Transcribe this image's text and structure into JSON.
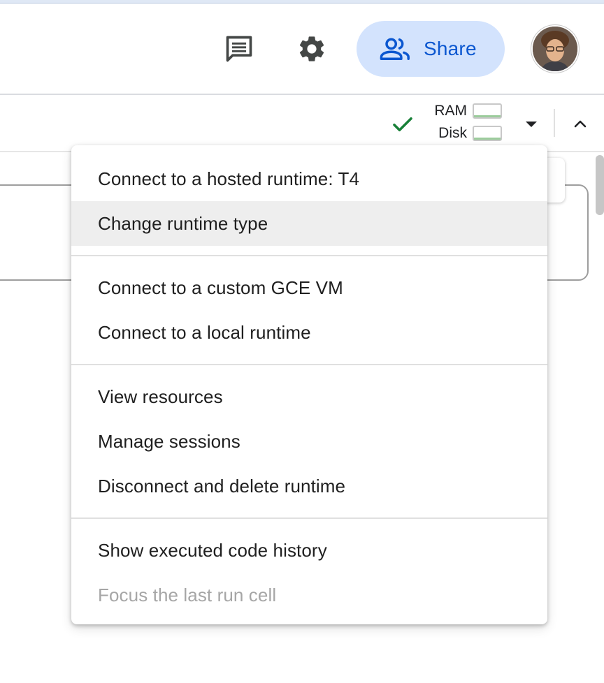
{
  "header": {
    "share_label": "Share",
    "icons": {
      "comment": "comment-icon",
      "settings": "gear-icon",
      "share": "people-icon",
      "avatar": "user-avatar"
    }
  },
  "toolbar": {
    "ram_label": "RAM",
    "disk_label": "Disk",
    "status_icon": "checkmark-icon",
    "dropdown_icon": "caret-down-icon",
    "collapse_icon": "chevron-up-icon"
  },
  "menu": {
    "groups": [
      [
        {
          "label": "Connect to a hosted runtime: T4",
          "highlighted": false,
          "disabled": false
        },
        {
          "label": "Change runtime type",
          "highlighted": true,
          "disabled": false
        }
      ],
      [
        {
          "label": "Connect to a custom GCE VM",
          "highlighted": false,
          "disabled": false
        },
        {
          "label": "Connect to a local runtime",
          "highlighted": false,
          "disabled": false
        }
      ],
      [
        {
          "label": "View resources",
          "highlighted": false,
          "disabled": false
        },
        {
          "label": "Manage sessions",
          "highlighted": false,
          "disabled": false
        },
        {
          "label": "Disconnect and delete runtime",
          "highlighted": false,
          "disabled": false
        }
      ],
      [
        {
          "label": "Show executed code history",
          "highlighted": false,
          "disabled": false
        },
        {
          "label": "Focus the last run cell",
          "highlighted": false,
          "disabled": true
        }
      ]
    ]
  },
  "colors": {
    "share_bg": "#d3e3fd",
    "share_text": "#0b57d0",
    "check_green": "#188038",
    "highlight_bg": "#eeeeee",
    "disabled_text": "#a6a6a6"
  }
}
